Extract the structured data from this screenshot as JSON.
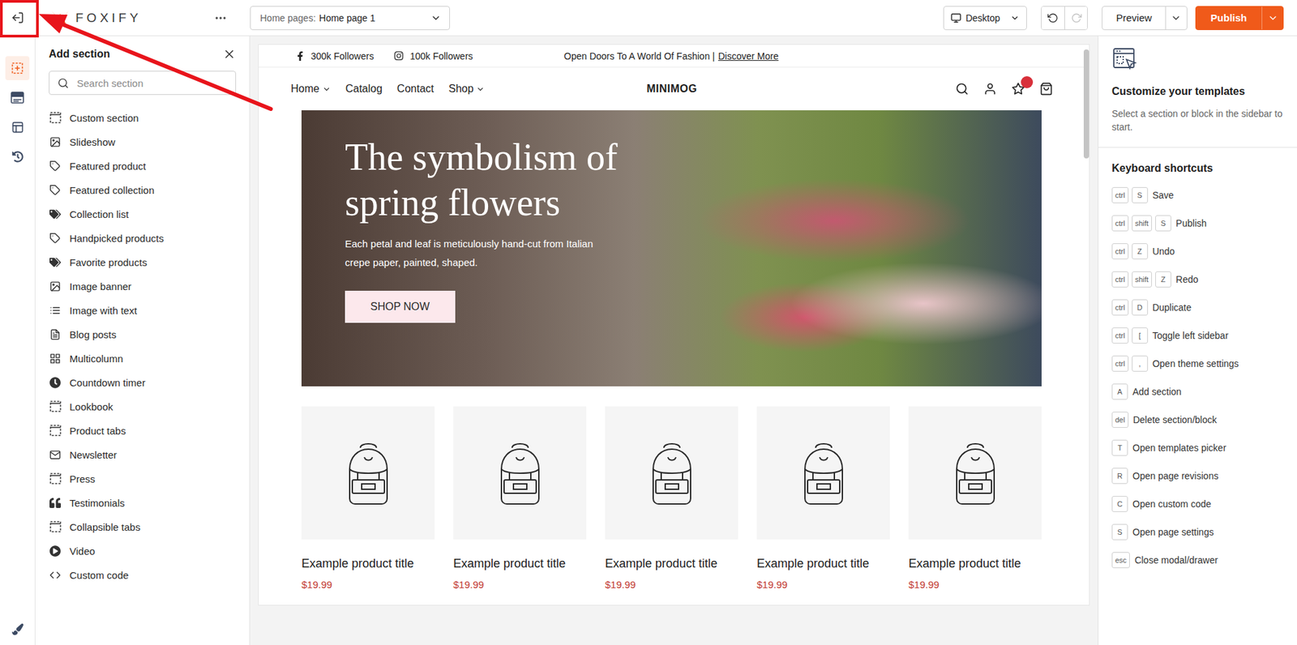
{
  "topbar": {
    "logo": "FOXIFY",
    "page_select": {
      "label": "Home pages:",
      "value": "Home page 1"
    },
    "device": "Desktop",
    "undo": {
      "disabled": false
    },
    "redo": {
      "disabled": true
    },
    "preview": "Preview",
    "publish": "Publish"
  },
  "rail": {
    "items": [
      {
        "kind": "add",
        "selected": true
      },
      {
        "kind": "sections",
        "selected": false
      },
      {
        "kind": "layout",
        "selected": false
      },
      {
        "kind": "history",
        "selected": false
      }
    ]
  },
  "add_section": {
    "title": "Add section",
    "search": {
      "placeholder": "Search section"
    },
    "items": [
      {
        "label": "Custom section",
        "kind": "dashed"
      },
      {
        "label": "Slideshow",
        "kind": "image"
      },
      {
        "label": "Featured product",
        "kind": "tag"
      },
      {
        "label": "Featured collection",
        "kind": "tag"
      },
      {
        "label": "Collection list",
        "kind": "tags"
      },
      {
        "label": "Handpicked products",
        "kind": "tag"
      },
      {
        "label": "Favorite products",
        "kind": "tags"
      },
      {
        "label": "Image banner",
        "kind": "image"
      },
      {
        "label": "Image with text",
        "kind": "image-text"
      },
      {
        "label": "Blog posts",
        "kind": "blog"
      },
      {
        "label": "Multicolumn",
        "kind": "columns"
      },
      {
        "label": "Countdown timer",
        "kind": "clock"
      },
      {
        "label": "Lookbook",
        "kind": "dashed"
      },
      {
        "label": "Product tabs",
        "kind": "dashed"
      },
      {
        "label": "Newsletter",
        "kind": "newsletter"
      },
      {
        "label": "Press",
        "kind": "dashed"
      },
      {
        "label": "Testimonials",
        "kind": "quote"
      },
      {
        "label": "Collapsible tabs",
        "kind": "dashed"
      },
      {
        "label": "Video",
        "kind": "play"
      },
      {
        "label": "Custom code",
        "kind": "code"
      }
    ]
  },
  "store": {
    "announcement": {
      "socials": [
        {
          "kind": "facebook",
          "label": "300k Followers"
        },
        {
          "kind": "instagram",
          "label": "100k Followers"
        }
      ],
      "message": "Open Doors To A World Of Fashion |",
      "link": "Discover More"
    },
    "nav": {
      "links": [
        {
          "label": "Home",
          "has_menu": true
        },
        {
          "label": "Catalog",
          "has_menu": false
        },
        {
          "label": "Contact",
          "has_menu": false
        },
        {
          "label": "Shop",
          "has_menu": true
        }
      ],
      "brand": "MINIMOG",
      "wishlist_badge": true
    },
    "hero": {
      "title_lines": [
        "The symbolism of",
        "spring flowers"
      ],
      "text_lines": [
        "Each petal and leaf is meticulously hand-cut from Italian",
        "crepe paper, painted, shaped."
      ],
      "button": "SHOP NOW"
    },
    "products": [
      {
        "title": "Example product title",
        "price": "$19.99"
      },
      {
        "title": "Example product title",
        "price": "$19.99"
      },
      {
        "title": "Example product title",
        "price": "$19.99"
      },
      {
        "title": "Example product title",
        "price": "$19.99"
      },
      {
        "title": "Example product title",
        "price": "$19.99"
      }
    ]
  },
  "inspector": {
    "title": "Customize your templates",
    "description": "Select a section or block in the sidebar to start.",
    "shortcuts_title": "Keyboard shortcuts",
    "shortcuts": [
      {
        "keys": [
          "ctrl",
          "S"
        ],
        "label": "Save"
      },
      {
        "keys": [
          "ctrl",
          "shift",
          "S"
        ],
        "label": "Publish"
      },
      {
        "keys": [
          "ctrl",
          "Z"
        ],
        "label": "Undo"
      },
      {
        "keys": [
          "ctrl",
          "shift",
          "Z"
        ],
        "label": "Redo"
      },
      {
        "keys": [
          "ctrl",
          "D"
        ],
        "label": "Duplicate"
      },
      {
        "keys": [
          "ctrl",
          "["
        ],
        "label": "Toggle left sidebar"
      },
      {
        "keys": [
          "ctrl",
          ","
        ],
        "label": "Open theme settings"
      },
      {
        "keys": [
          "A"
        ],
        "label": "Add section"
      },
      {
        "keys": [
          "del"
        ],
        "label": "Delete section/block"
      },
      {
        "keys": [
          "T"
        ],
        "label": "Open templates picker"
      },
      {
        "keys": [
          "R"
        ],
        "label": "Open page revisions"
      },
      {
        "keys": [
          "C"
        ],
        "label": "Open custom code"
      },
      {
        "keys": [
          "S"
        ],
        "label": "Open page settings"
      },
      {
        "keys": [
          "esc"
        ],
        "label": "Close modal/drawer"
      }
    ]
  },
  "annotation": {
    "visible": true
  }
}
